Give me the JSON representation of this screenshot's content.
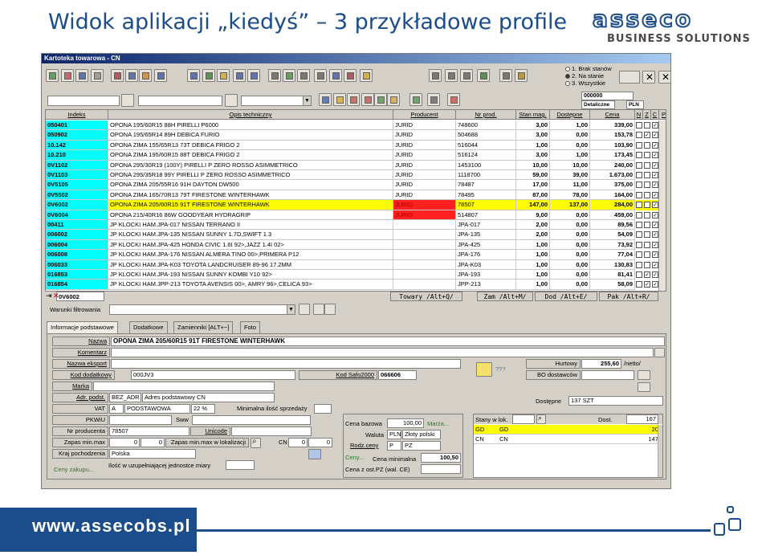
{
  "slide": {
    "title": "Widok aplikacji „kiedyś” – 3 przykładowe profile",
    "logo_word": "asseco",
    "logo_sub": "BUSINESS SOLUTIONS",
    "footer_url": "www.assecobs.pl"
  },
  "app": {
    "window_title": "Kartoteka towarowa - CN",
    "radio_options": [
      "1. Brak stanów",
      "2. Na stanie",
      "3. Wszystkie"
    ],
    "radio_selected": 1,
    "filter_code": "000000",
    "price_type": "Detaliczne",
    "currency": "PLN",
    "grid": {
      "columns": [
        "Indeks",
        "Opis techniczny",
        "Producent",
        "Nr prod.",
        "Stan mag.",
        "Dostępne",
        "Cena",
        "N",
        "Z",
        "C",
        "P"
      ],
      "rows": [
        {
          "idx": "050401",
          "opis": "OPONA 195/60R15 88H PIRELLI P6000",
          "prod": "JURID",
          "nr": "748600",
          "stan": "3,00",
          "dost": "1,00",
          "cena": "339,00",
          "z": false,
          "c": true,
          "p": false
        },
        {
          "idx": "050902",
          "opis": "OPONA 195/65R14 89H DEBICA FURIO",
          "prod": "JURID",
          "nr": "504688",
          "stan": "3,00",
          "dost": "0,00",
          "cena": "153,78",
          "z": true,
          "c": true,
          "p": false
        },
        {
          "idx": "10.142",
          "opis": "OPONA ZIMA 155/65R13 73T DEBICA FRIGO 2",
          "prod": "JURID",
          "nr": "516044",
          "stan": "1,00",
          "dost": "0,00",
          "cena": "103,90",
          "z": false,
          "c": true,
          "p": false
        },
        {
          "idx": "10.210",
          "opis": "OPONA ZIMA 195/60R15 88T DEBICA FRIGO 2",
          "prod": "JURID",
          "nr": "516124",
          "stan": "3,00",
          "dost": "1,00",
          "cena": "173,45",
          "z": false,
          "c": true,
          "p": false
        },
        {
          "idx": "0V1102",
          "opis": "OPONA 295/30R19 (100Y)  PIRELLI P ZERO ROSSO ASIMMETRICO",
          "prod": "JURID",
          "nr": "1453100",
          "stan": "10,00",
          "dost": "10,00",
          "cena": "240,00",
          "z": false,
          "c": true,
          "p": false
        },
        {
          "idx": "0V1103",
          "opis": "OPONA 295/35R18 99Y PIRELLI P ZERO ROSSO ASIMMETRICO",
          "prod": "JURID",
          "nr": "1118700",
          "stan": "59,00",
          "dost": "39,00",
          "cena": "1.673,00",
          "z": false,
          "c": true,
          "p": false
        },
        {
          "idx": "0V5105",
          "opis": "OPONA ZIMA 205/55R16 91H DAYTON DW500",
          "prod": "JURID",
          "nr": "78487",
          "stan": "17,00",
          "dost": "11,00",
          "cena": "375,00",
          "z": false,
          "c": true,
          "p": true
        },
        {
          "idx": "0V5502",
          "opis": "OPONA ZIMA 165/70R13 79T FIRESTONE WINTERHAWK",
          "prod": "JURID",
          "nr": "78495",
          "stan": "87,00",
          "dost": "78,00",
          "cena": "164,00",
          "z": false,
          "c": true,
          "p": true
        },
        {
          "idx": "0V6002",
          "opis": "OPONA ZIMA 205/60R15 91T FIRESTONE WINTERHAWK",
          "prod": "JURID",
          "nr": "78507",
          "stan": "147,00",
          "dost": "137,00",
          "cena": "284,00",
          "z": false,
          "c": true,
          "p": true,
          "selected": true
        },
        {
          "idx": "0V6004",
          "opis": "OPONA 215/40R16 86W GOODYEAR HYDRAGRIP",
          "prod": "JURID",
          "nr": "514807",
          "stan": "9,00",
          "dost": "0,00",
          "cena": "459,00",
          "z": false,
          "c": true,
          "p": true,
          "red": true
        },
        {
          "idx": "00411",
          "opis": "JP KLOCKI HAM.JPA-017 NISSAN TERRANO II",
          "prod": "",
          "nr": "JPA-017",
          "stan": "2,00",
          "dost": "0,00",
          "cena": "89,56",
          "z": false,
          "c": true,
          "p": false
        },
        {
          "idx": "006002",
          "opis": "JP KLOCKI HAM.JPA-135 NISSAN SUNNY 1.7D,SWIFT 1.3",
          "prod": "",
          "nr": "JPA-135",
          "stan": "2,00",
          "dost": "0,00",
          "cena": "54,09",
          "z": false,
          "c": true,
          "p": false
        },
        {
          "idx": "006004",
          "opis": "JP KLOCKI HAM.JPA-425 HONDA CIVIC 1.6I 92>,JAZZ 1.4I 02>",
          "prod": "",
          "nr": "JPA-425",
          "stan": "1,00",
          "dost": "0,00",
          "cena": "73,92",
          "z": false,
          "c": true,
          "p": false
        },
        {
          "idx": "006008",
          "opis": "JP KLOCKI HAM.JPA-176 NISSAN ALMERA TINO 00>,PRIMERA P12",
          "prod": "",
          "nr": "JPA-176",
          "stan": "1,00",
          "dost": "0,00",
          "cena": "77,04",
          "z": false,
          "c": true,
          "p": false
        },
        {
          "idx": "006033",
          "opis": "JP KLOCKI HAM.JPA-K03 TOYOTA LANDCRUISER 89-96 17.2MM",
          "prod": "",
          "nr": "JPA-K03",
          "stan": "1,00",
          "dost": "0,00",
          "cena": "130,83",
          "z": false,
          "c": true,
          "p": false
        },
        {
          "idx": "016853",
          "opis": "JP KLOCKI HAM.JPA-193 NISSAN SUNNY KOMBI Y10 92>",
          "prod": "",
          "nr": "JPA-193",
          "stan": "1,00",
          "dost": "0,00",
          "cena": "81,41",
          "z": true,
          "c": true,
          "p": false
        },
        {
          "idx": "016854",
          "opis": "JP KLOCKI HAM.JPP-213 TOYOTA AVENSIS 00>, AMRY 96>,CELICA 93>",
          "prod": "",
          "nr": "JPP-213",
          "stan": "1,00",
          "dost": "0,00",
          "cena": "58,09",
          "z": true,
          "c": true,
          "p": false
        }
      ],
      "current_index": "0V6002",
      "foot_tabs": [
        "Towary /Alt+Q/",
        "Zam /Alt+M/",
        "Dod /Alt+E/",
        "Pak /Alt+R/"
      ]
    },
    "filter": {
      "label": "Warunki filtrowania",
      "value": ""
    },
    "tabs": [
      "Informacje podstawowe",
      "Dodatkowe",
      "Zamienniki [ALT+~]",
      "Foto"
    ],
    "form": {
      "nazwa_label": "Nazwa",
      "nazwa": "OPONA ZIMA 205/60R15 91T FIRESTONE WINTERHAWK",
      "komentarz_label": "Komentarz",
      "nazwa_eksport_label": "Nazwa eksport",
      "kod_dodatkowy_label": "Kod dodatkowy",
      "kod_dodatkowy": "000JV3",
      "kod_safo_label": "Kod Safo2000",
      "kod_safo": "066606",
      "marka_label": "Marka",
      "adr_podst_label": "Adr. podst.",
      "adr_podst_code": "BEZ_ADR",
      "adr_podst_name": "Adres podstawowy CN",
      "vat_label": "VAT",
      "vat_code": "A",
      "vat_name": "PODSTAWOWA",
      "vat_rate": "22 %",
      "min_sprzedazy_label": "Minimalna ilość sprzedaży",
      "pkwiu_label": "PKWiU",
      "sww_label": "Sww",
      "nr_producenta_label": "Nr producenta",
      "nr_producenta": "78507",
      "unicode_label": "Unicode",
      "zapas_label": "Zapas min.max",
      "zapas_min": "0",
      "zapas_max": "0",
      "zapas_lok_label": "Zapas min.max w lokalizacji",
      "cn_label": "CN",
      "cn_min": "0",
      "cn_max": "0",
      "kraj_label": "Kraj pochodzenia",
      "kraj": "Polska",
      "ilosc_label": "Ilość w uzupełniającej jednostce miary",
      "ceny_zakupu": "Ceny zakupu...",
      "hurtowy_label": "Hurtowy",
      "hurtowy": "255,60",
      "hurtowy_unit": "/netto/",
      "bo_label": "BO dostawców",
      "qqq": "???",
      "dostepne_label": "Dostępne",
      "dostepne": "137 SZT",
      "cena_bazowa_label": "Cena bazowa",
      "cena_bazowa": "100,00",
      "marza": "Marża...",
      "waluta_label": "Waluta",
      "waluta_code": "PLN",
      "waluta_name": "Złoty polski",
      "rodz_ceny_label": "Rodz.ceny",
      "rodz_ceny_code": "P",
      "rodz_ceny_name": "PZ",
      "ceny_btn": "Ceny...",
      "cena_min_label": "Cena minimalna",
      "cena_min": "100,50",
      "cena_pz_label": "Cena z ost.PZ (wal. CE)",
      "stany_label": "Stany w lok.",
      "dost_label": "Dost.",
      "stany_total": "167",
      "stany_rows": [
        {
          "a": "GD",
          "b": "GD",
          "v": "20",
          "hl": true
        },
        {
          "a": "CN",
          "b": "CN",
          "v": "147",
          "hl": false
        }
      ]
    }
  }
}
